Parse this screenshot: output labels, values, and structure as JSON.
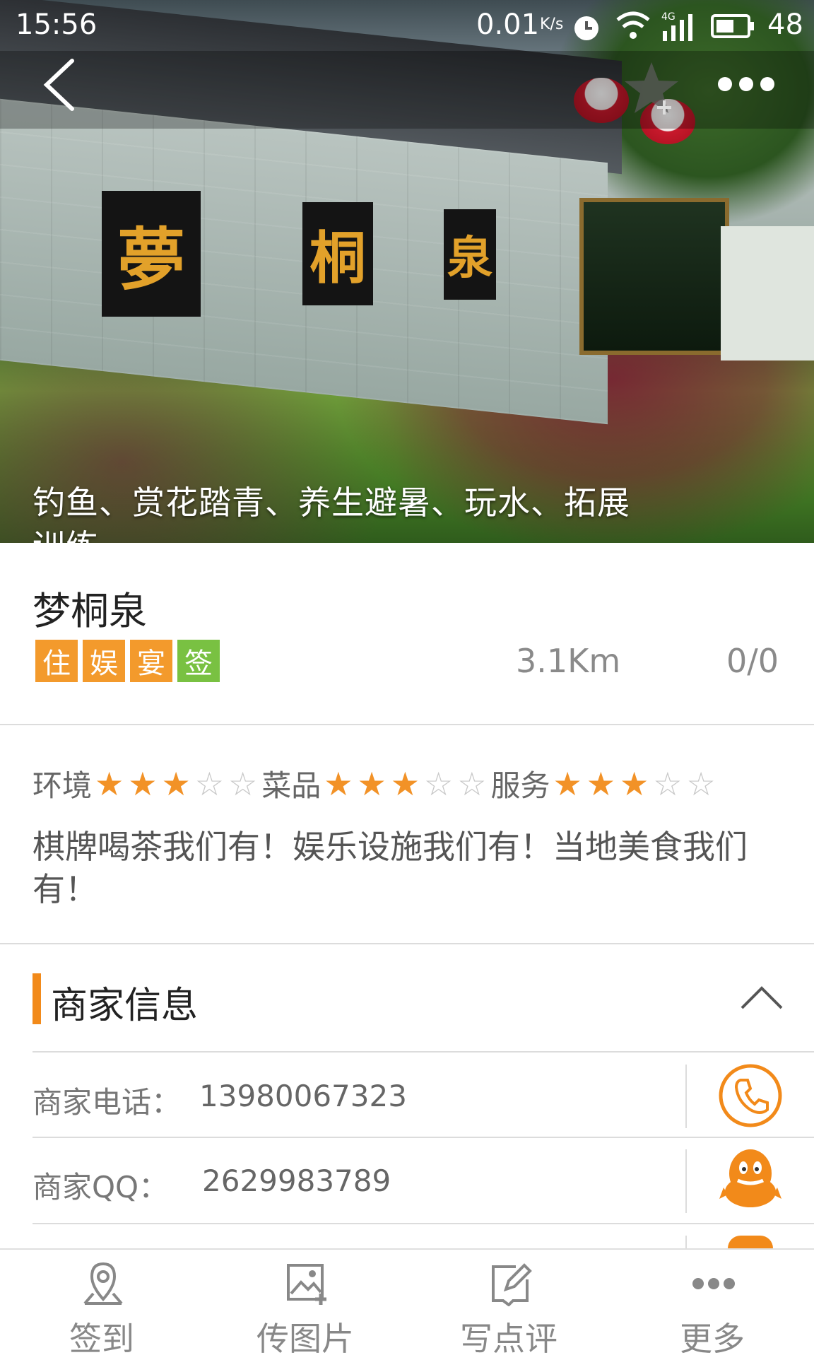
{
  "status_bar": {
    "time": "15:56",
    "speed": "0.01",
    "speed_unit": "K/s",
    "battery": "48"
  },
  "hero": {
    "tags_line1": "钓鱼、赏花踏青、养生避暑、玩水、拓展",
    "tags_line2": "训练",
    "plaque_chars": [
      "夢",
      "桐",
      "泉"
    ]
  },
  "merchant": {
    "name": "梦桐泉",
    "badges": [
      {
        "label": "住",
        "color": "#f39a2c"
      },
      {
        "label": "娱",
        "color": "#f39a2c"
      },
      {
        "label": "宴",
        "color": "#f39a2c"
      },
      {
        "label": "签",
        "color": "#79c142"
      }
    ],
    "distance": "3.1Km",
    "count": "0/0"
  },
  "ratings": [
    {
      "label": "环境",
      "stars": 3,
      "max": 5
    },
    {
      "label": "菜品",
      "stars": 3,
      "max": 5
    },
    {
      "label": "服务",
      "stars": 3,
      "max": 5
    }
  ],
  "description": "棋牌喝茶我们有！娱乐设施我们有！当地美食我们有！",
  "info": {
    "section_title": "商家信息",
    "phone_label": "商家电话：",
    "phone": "13980067323",
    "qq_label": "商家QQ：",
    "qq": "2629983789"
  },
  "bottom_nav": [
    {
      "label": "签到",
      "icon": "location-pin-icon"
    },
    {
      "label": "传图片",
      "icon": "upload-image-icon"
    },
    {
      "label": "写点评",
      "icon": "write-review-icon"
    },
    {
      "label": "更多",
      "icon": "more-dots-icon"
    }
  ],
  "colors": {
    "accent": "#f28a1a",
    "star": "#f29227",
    "badge_orange": "#f39a2c",
    "badge_green": "#79c142"
  }
}
